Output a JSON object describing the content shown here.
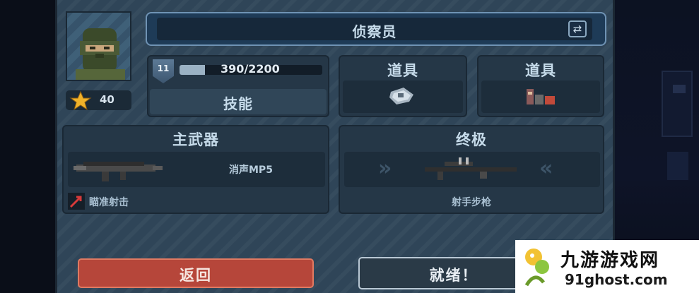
{
  "character": {
    "name": "侦察员",
    "level": "11",
    "xp_text": "390/2200",
    "xp_fraction": 0.177,
    "stars": "40"
  },
  "labels": {
    "skill": "技能",
    "item1": "道具",
    "item2": "道具",
    "primary_weapon": "主武器",
    "ultimate": "终极"
  },
  "primary": {
    "weapon_name": "消声MP5",
    "ability": "瞄准射击"
  },
  "ultimate": {
    "weapon_name": "射手步枪"
  },
  "buttons": {
    "back": "返回",
    "ready": "就绪！"
  },
  "watermark": {
    "main": "九游游戏网",
    "sub": "91ghost.com"
  },
  "colors": {
    "panel": "#2f4558",
    "back_button": "#b6463a",
    "title_border": "#6f93b4"
  }
}
